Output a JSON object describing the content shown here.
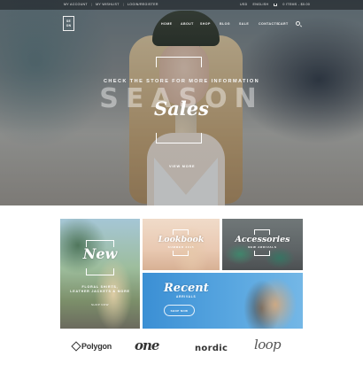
{
  "utility": {
    "links": [
      "My Account",
      "My Wishlist",
      "Login/Register"
    ],
    "currency": "USD",
    "language": "English",
    "cart": "0 Items - $0.00"
  },
  "logo": {
    "line1": "SE",
    "line2": "ON"
  },
  "nav": [
    "Home",
    "About",
    "Shop",
    "Blog",
    "Sale",
    "Contacts",
    "Cart"
  ],
  "hero": {
    "kicker": "Check the store for more information",
    "season": "Season",
    "sales": "Sales",
    "button": "View More"
  },
  "promos": {
    "new": {
      "title": "New",
      "desc_line1": "Floral Shirts,",
      "desc_line2": "Leather Jackets & More",
      "button": "Shop Now"
    },
    "lookbook": {
      "title": "Lookbook",
      "sub": "Summer 2015"
    },
    "accessories": {
      "title": "Accessories",
      "sub": "New Arrivals"
    },
    "recent": {
      "title": "Recent",
      "sub": "Arrivals",
      "button": "Shop Now"
    }
  },
  "brands": [
    "Polygon",
    "one",
    "nordic",
    "loop"
  ]
}
